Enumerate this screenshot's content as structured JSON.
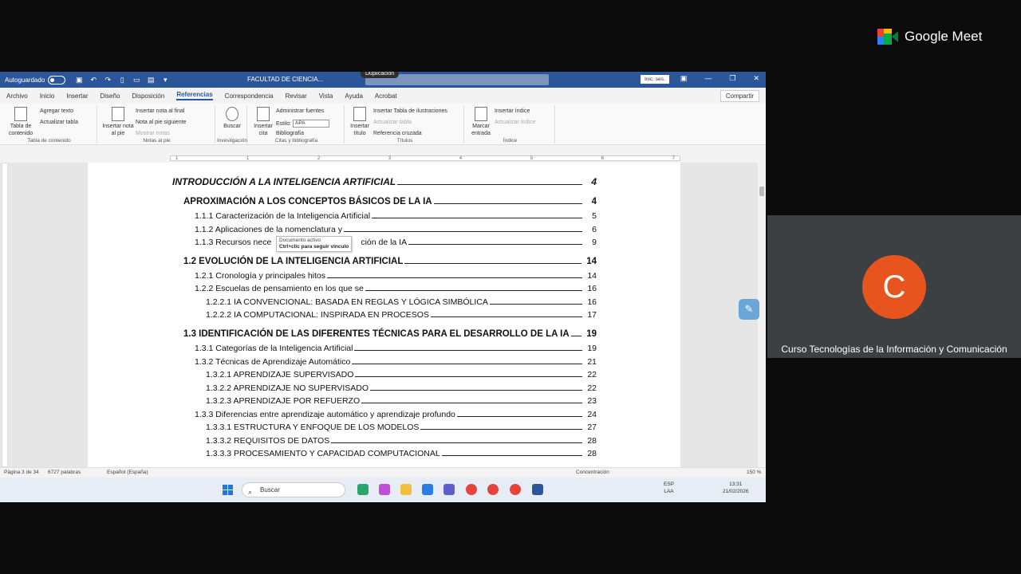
{
  "meet": {
    "brand": "Google Meet",
    "participant_initial": "C",
    "participant_name": "Curso Tecnologías de la Información y Comunicación",
    "colors": {
      "avatar": "#e8541d",
      "tile": "#3c4043"
    }
  },
  "word": {
    "autosave_label": "Autoguardado",
    "doc_title": "FACULTAD DE CIENCIA...",
    "tooltip_duplicacion": "Duplicación",
    "signin": "Inic. ses.",
    "share": "Compartir",
    "menu": [
      "Archivo",
      "Inicio",
      "Insertar",
      "Diseño",
      "Disposición",
      "Referencias",
      "Correspondencia",
      "Revisar",
      "Vista",
      "Ayuda",
      "Acrobat"
    ],
    "ribbon": {
      "toc_button": "Tabla de contenido",
      "add_text": "Agregar texto",
      "update_table": "Actualizar tabla",
      "group_toc": "Tabla de contenido",
      "insert_footnote": "Insertar nota al pie",
      "insert_endnote": "Insertar nota al final",
      "next_footnote": "Nota al pie siguiente",
      "show_notes": "Mostrar notas",
      "group_footnotes": "Notas al pie",
      "search": "Buscar",
      "group_research": "Investigación",
      "insert_citation": "Insertar cita",
      "manage_sources": "Administrar fuentes",
      "style_label": "Estilo:",
      "style_value": "APA",
      "bibliography": "Bibliografía",
      "group_citations": "Citas y bibliografía",
      "insert_caption": "Insertar título",
      "insert_table_figures": "Insertar Tabla de ilustraciones",
      "update_table2": "Actualizar tabla",
      "cross_reference": "Referencia cruzada",
      "group_captions": "Títulos",
      "mark_entry": "Marcar entrada",
      "insert_index": "Insertar índice",
      "update_index": "Actualizar índice",
      "group_index": "Índice"
    },
    "ruler_ticks": [
      "1",
      "1",
      "2",
      "3",
      "4",
      "5",
      "6",
      "7"
    ],
    "hover_tooltip": {
      "title": "Documento activo",
      "hint": "Ctrl+clic para seguir vínculo"
    },
    "toc": [
      {
        "text": "INTRODUCCIÓN A LA INTELIGENCIA ARTIFICIAL",
        "page": "4"
      },
      {
        "text": "APROXIMACIÓN A LOS CONCEPTOS BÁSICOS DE LA IA",
        "page": "4"
      },
      {
        "text": "1.1.1 Caracterización de la Inteligencia Artificial",
        "page": "5"
      },
      {
        "text": "1.1.2 Aplicaciones de la nomenclatura y",
        "page": "6"
      },
      {
        "text": "1.1.3 Recursos nece",
        "text_b": "ción de la IA",
        "page": "9"
      },
      {
        "text": "1.2 EVOLUCIÓN DE LA INTELIGENCIA ARTIFICIAL",
        "page": "14"
      },
      {
        "text": "1.2.1 Cronología y principales hitos",
        "page": "14"
      },
      {
        "text": "1.2.2 Escuelas de pensamiento en los que se",
        "page": "16"
      },
      {
        "text": "1.2.2.1 IA CONVENCIONAL: BASADA EN REGLAS Y LÓGICA SIMBÓLICA",
        "page": "16"
      },
      {
        "text": "1.2.2.2 IA COMPUTACIONAL: INSPIRADA EN PROCESOS",
        "page": "17"
      },
      {
        "text": "1.3 IDENTIFICACIÓN DE LAS DIFERENTES TÉCNICAS PARA EL DESARROLLO DE LA IA",
        "page": "19"
      },
      {
        "text": "1.3.1 Categorías de la Inteligencia Artificial",
        "page": "19"
      },
      {
        "text": "1.3.2 Técnicas de Aprendizaje Automático",
        "page": "21"
      },
      {
        "text": "1.3.2.1 APRENDIZAJE SUPERVISADO",
        "page": "22"
      },
      {
        "text": "1.3.2.2 APRENDIZAJE NO SUPERVISADO",
        "page": "22"
      },
      {
        "text": "1.3.2.3 APRENDIZAJE POR REFUERZO",
        "page": "23"
      },
      {
        "text": "1.3.3 Diferencias entre aprendizaje automático y aprendizaje profundo",
        "page": "24"
      },
      {
        "text": "1.3.3.1 ESTRUCTURA Y ENFOQUE DE LOS MODELOS",
        "page": "27"
      },
      {
        "text": "1.3.3.2 REQUISITOS DE DATOS",
        "page": "28"
      },
      {
        "text": "1.3.3.3 PROCESAMIENTO Y CAPACIDAD COMPUTACIONAL",
        "page": "28"
      }
    ],
    "status": {
      "page": "Página 3 de 34",
      "words": "6727 palabras",
      "language": "Español (España)",
      "focus": "Concentración",
      "zoom": "150 %"
    }
  },
  "taskbar": {
    "search": "Buscar",
    "lang_top": "ESP",
    "lang_bottom": "LAA",
    "time": "13:31",
    "date": "21/02/2026"
  }
}
